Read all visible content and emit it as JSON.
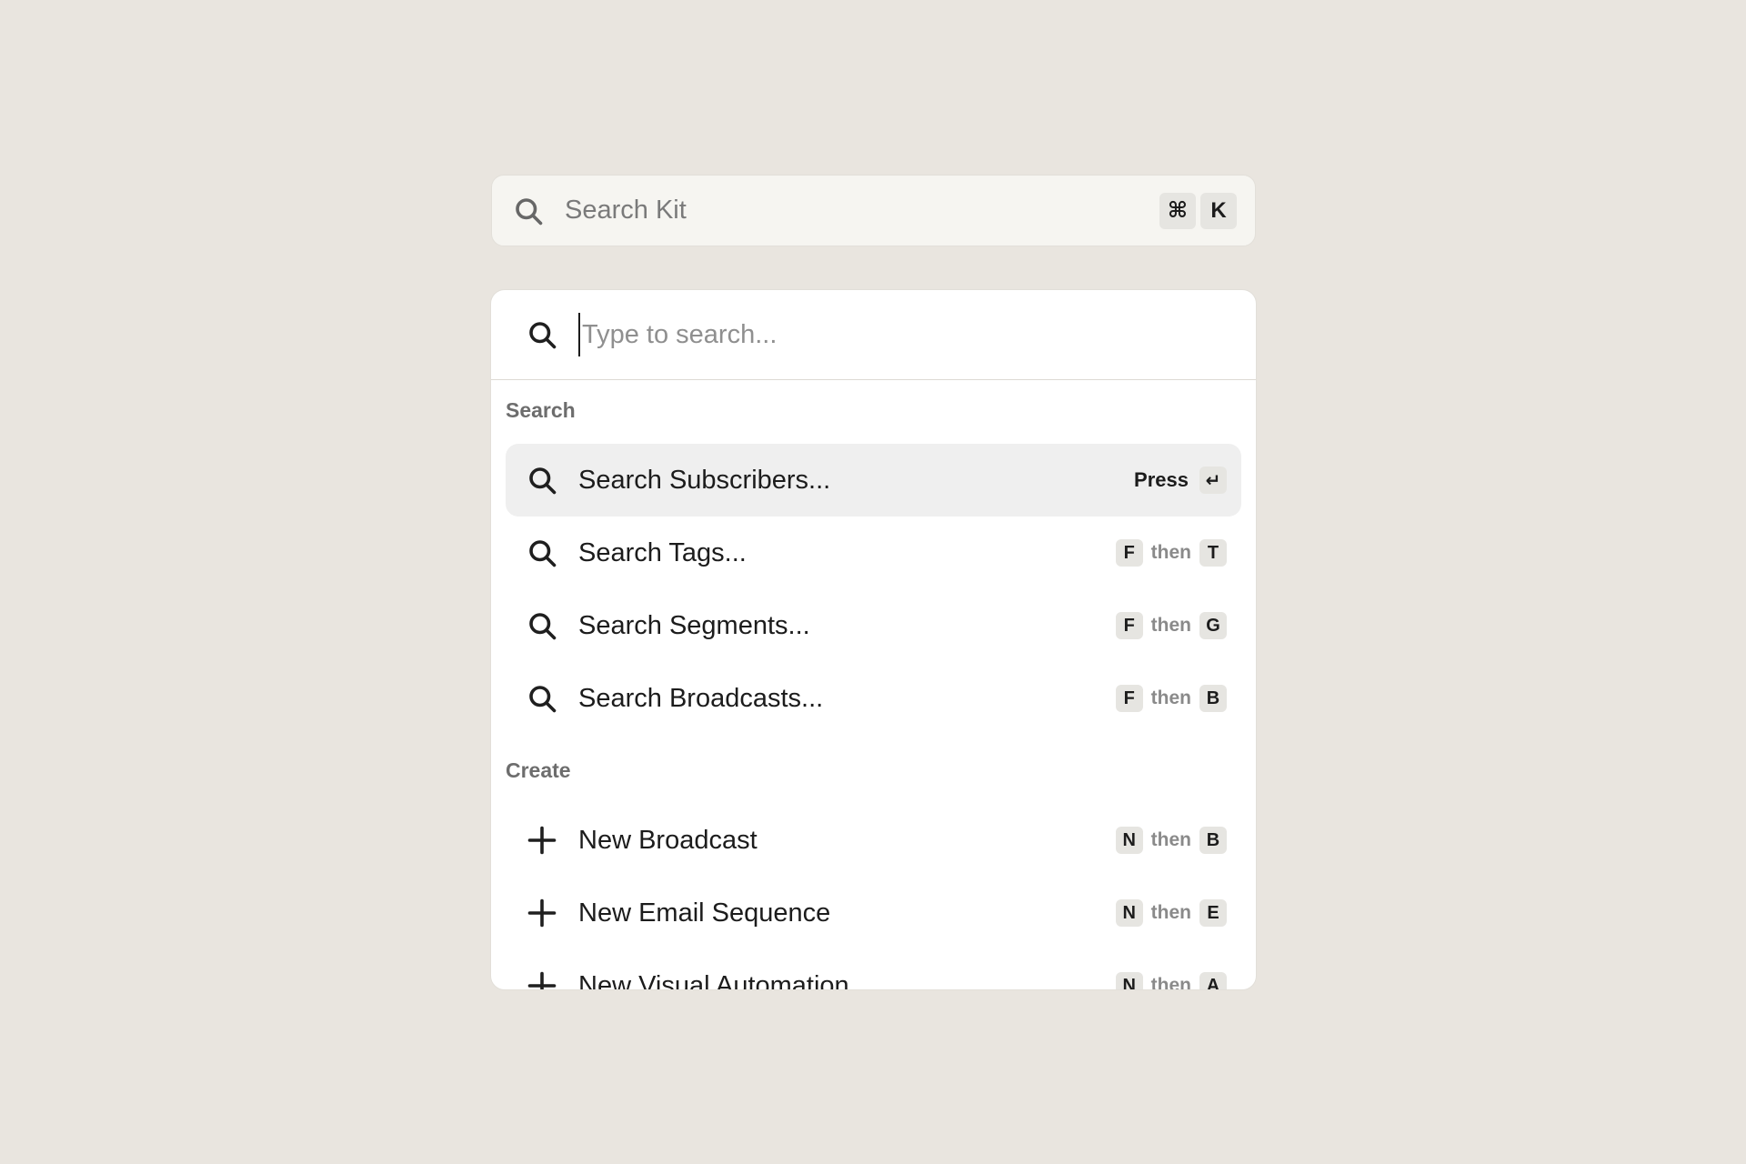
{
  "trigger": {
    "placeholder": "Search Kit",
    "keys": [
      "⌘",
      "K"
    ]
  },
  "palette": {
    "input_placeholder": "Type to search...",
    "groups": [
      {
        "label": "Search",
        "items": [
          {
            "label": "Search Subscribers...",
            "icon": "search-icon",
            "shortcut": {
              "press": "Press",
              "key": "↵"
            }
          },
          {
            "label": "Search Tags...",
            "icon": "search-icon",
            "shortcut": {
              "first": "F",
              "then": "then",
              "second": "T"
            }
          },
          {
            "label": "Search Segments...",
            "icon": "search-icon",
            "shortcut": {
              "first": "F",
              "then": "then",
              "second": "G"
            }
          },
          {
            "label": "Search Broadcasts...",
            "icon": "search-icon",
            "shortcut": {
              "first": "F",
              "then": "then",
              "second": "B"
            }
          }
        ]
      },
      {
        "label": "Create",
        "items": [
          {
            "label": "New Broadcast",
            "icon": "plus-icon",
            "shortcut": {
              "first": "N",
              "then": "then",
              "second": "B"
            }
          },
          {
            "label": "New Email Sequence",
            "icon": "plus-icon",
            "shortcut": {
              "first": "N",
              "then": "then",
              "second": "E"
            }
          },
          {
            "label": "New Visual Automation",
            "icon": "plus-icon",
            "shortcut": {
              "first": "N",
              "then": "then",
              "second": "A"
            }
          }
        ]
      }
    ]
  },
  "colors": {
    "background": "#e9e5df",
    "active_row": "#efefef",
    "kbd": "#e6e5e1"
  }
}
